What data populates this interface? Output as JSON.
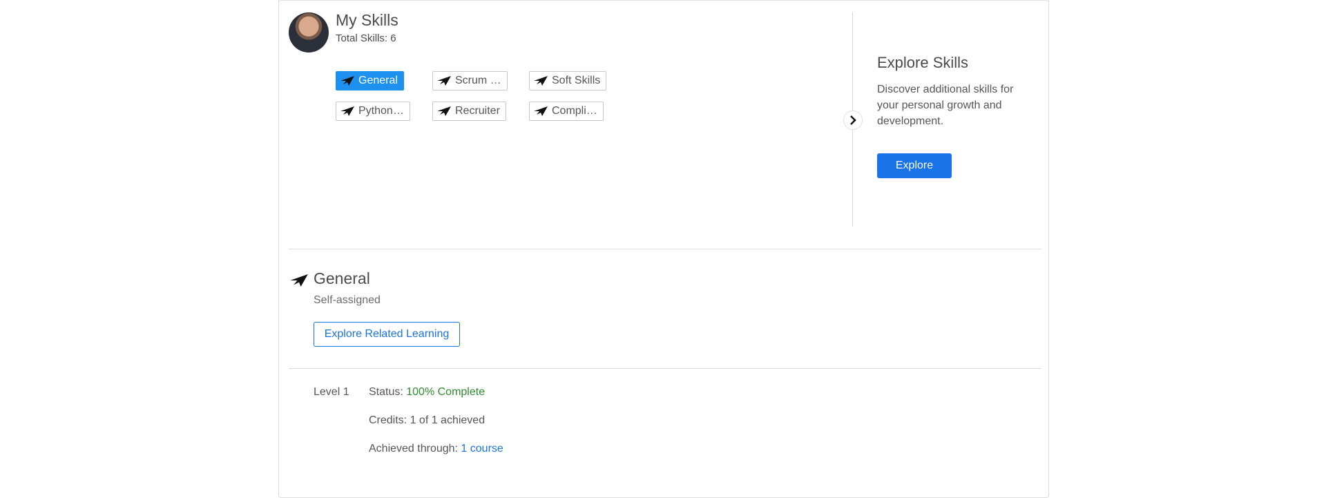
{
  "header": {
    "title": "My Skills",
    "total_skills": "Total Skills: 6"
  },
  "skills": [
    {
      "label": "General",
      "active": true
    },
    {
      "label": "Scrum …",
      "active": false
    },
    {
      "label": "Soft Skills",
      "active": false
    },
    {
      "label": "Python…",
      "active": false
    },
    {
      "label": "Recruiter",
      "active": false
    },
    {
      "label": "Compli…",
      "active": false
    }
  ],
  "explore": {
    "title": "Explore Skills",
    "description": "Discover additional skills for your personal growth and development.",
    "button_label": "Explore"
  },
  "detail": {
    "name": "General",
    "assignment": "Self-assigned",
    "related_button": "Explore Related Learning",
    "level": "Level 1",
    "status_label": "Status: ",
    "status_value": "100% Complete",
    "credits": "Credits: 1 of 1 achieved",
    "achieved_label": "Achieved through: ",
    "achieved_link": "1 course"
  },
  "colors": {
    "accent": "#1a73e8",
    "chip_active": "#1e90f0",
    "status_green": "#2e8b2e"
  }
}
